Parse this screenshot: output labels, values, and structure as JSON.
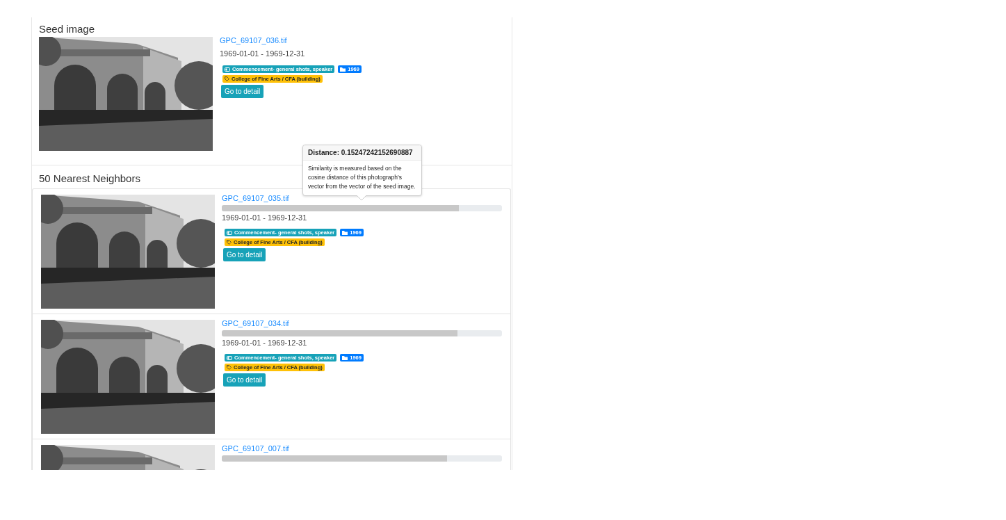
{
  "seed": {
    "heading": "Seed image",
    "file": "GPC_69107_036.tif",
    "date": "1969-01-01 - 1969-12-31",
    "tags": [
      {
        "kind": "collection",
        "label": "Commencement- general shots, speaker"
      },
      {
        "kind": "year",
        "label": "1969"
      },
      {
        "kind": "subject",
        "label": "College of Fine Arts / CFA (building)"
      }
    ],
    "button": "Go to detail"
  },
  "neighbors": {
    "heading": "50 Nearest Neighbors",
    "items": [
      {
        "file": "GPC_69107_035.tif",
        "level": 0.845,
        "date": "1969-01-01 - 1969-12-31",
        "tags": [
          {
            "kind": "collection",
            "label": "Commencement- general shots, speaker"
          },
          {
            "kind": "year",
            "label": "1969"
          },
          {
            "kind": "subject",
            "label": "College of Fine Arts / CFA (building)"
          }
        ],
        "button": "Go to detail"
      },
      {
        "file": "GPC_69107_034.tif",
        "level": 0.84,
        "date": "1969-01-01 - 1969-12-31",
        "tags": [
          {
            "kind": "collection",
            "label": "Commencement- general shots, speaker"
          },
          {
            "kind": "year",
            "label": "1969"
          },
          {
            "kind": "subject",
            "label": "College of Fine Arts / CFA (building)"
          }
        ],
        "button": "Go to detail"
      },
      {
        "file": "GPC_69107_007.tif",
        "level": 0.805
      }
    ]
  },
  "tooltip": {
    "title": "Distance: 0.15247242152690887",
    "body": "Similarity is measured based on the cosine distance of this photograph's vector from the vector of the seed image."
  }
}
